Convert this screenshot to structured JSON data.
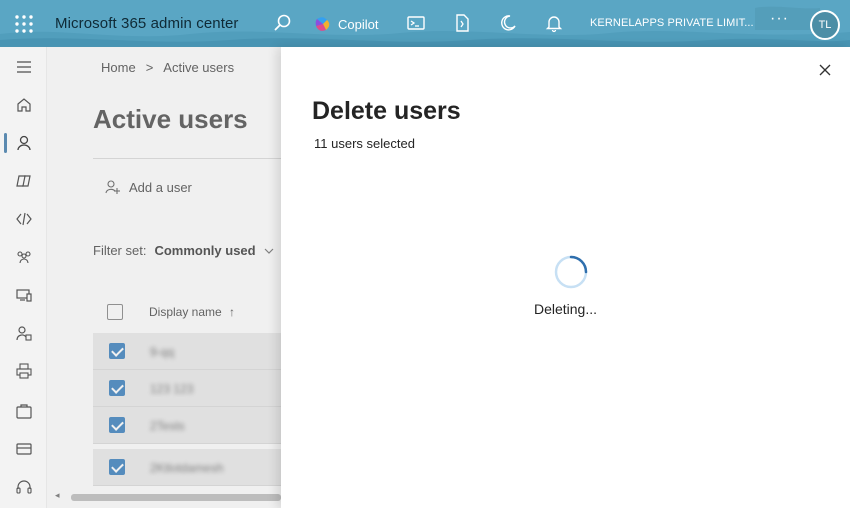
{
  "header": {
    "app_title": "Microsoft 365 admin center",
    "copilot_label": "Copilot",
    "tenant_name": "KERNELAPPS PRIVATE LIMIT...",
    "more_label": "···",
    "avatar_initials": "TL",
    "icons": [
      "waffle-icon",
      "search-icon",
      "copilot-icon",
      "terminal-icon",
      "document-icon",
      "moon-icon",
      "bell-icon"
    ]
  },
  "rail": {
    "icons": [
      "menu-icon",
      "home-icon",
      "users-icon",
      "copilot-apps-icon",
      "code-icon",
      "groups-icon",
      "devices-icon",
      "roles-icon",
      "print-icon",
      "briefcase-icon",
      "billing-icon",
      "support-icon"
    ],
    "active": "users-icon"
  },
  "page": {
    "breadcrumb": {
      "home": "Home",
      "separator": ">",
      "current": "Active users"
    },
    "title": "Active users",
    "add_user_label": "Add a user",
    "filter_label": "Filter set:",
    "filter_value": "Commonly used",
    "column_display_name": "Display name",
    "sort_arrow": "↑",
    "rows": [
      {
        "name": "9-qq",
        "checked": true
      },
      {
        "name": "123 123",
        "checked": true
      },
      {
        "name": "2Tests",
        "checked": true
      },
      {
        "name": "2Ktlotdamesh",
        "checked": true
      }
    ]
  },
  "panel": {
    "title": "Delete users",
    "subtitle": "11 users selected",
    "status": "Deleting...",
    "close_icon": "close-icon"
  },
  "colors": {
    "header_bg": "#5aa6c4",
    "accent": "#5b95c9",
    "spinner": "#2f6fad"
  }
}
